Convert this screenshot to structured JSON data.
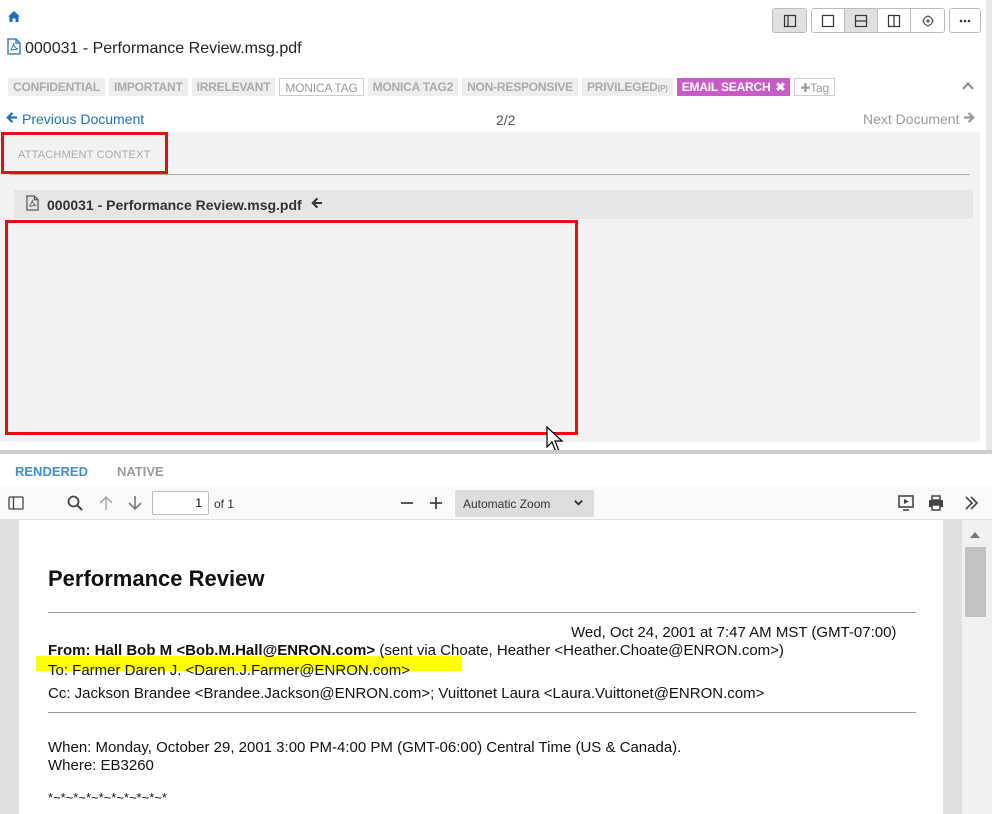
{
  "header": {
    "home_icon": "home-icon",
    "title": "000031 - Performance Review.msg.pdf"
  },
  "toolbar": {
    "layout_icons": [
      "sidebar-layout-icon",
      "single-pane-icon",
      "horizontal-split-icon",
      "vertical-split-icon",
      "settings-wheel-icon"
    ],
    "more_icon": "ellipsis-icon"
  },
  "tags": [
    {
      "label": "CONFIDENTIAL"
    },
    {
      "label": "IMPORTANT"
    },
    {
      "label": "IRRELEVANT"
    },
    {
      "label": "MONICA TAG"
    },
    {
      "label": "MONICA TAG2"
    },
    {
      "label": "NON-RESPONSIVE"
    },
    {
      "label": "PRIVILEGED",
      "suffix": "(P)"
    },
    {
      "label": "EMAIL SEARCH"
    },
    {
      "label": "Tag"
    }
  ],
  "nav": {
    "previous": "Previous Document",
    "count": "2/2",
    "next": "Next Document"
  },
  "attachment": {
    "title": "ATTACHMENT CONTEXT",
    "file": "000031 - Performance Review.msg.pdf"
  },
  "viewer_tabs": [
    "RENDERED",
    "NATIVE"
  ],
  "pdf_toolbar": {
    "page": "1",
    "of": "of 1",
    "zoom": "Automatic Zoom"
  },
  "email": {
    "title": "Performance Review",
    "date": "Wed, Oct 24, 2001 at 7:47 AM MST (GMT-07:00)",
    "from_bold": "From: Hall Bob M <Bob.M.Hall@ENRON.com>",
    "from_rest": " (sent via Choate, Heather <Heather.Choate@ENRON.com>)",
    "to": "To: Farmer Daren J. <Daren.J.Farmer@ENRON.com>",
    "cc": "Cc: Jackson Brandee <Brandee.Jackson@ENRON.com>; Vuittonet Laura <Laura.Vuittonet@ENRON.com>",
    "when": "When: Monday, October 29, 2001 3:00 PM-4:00 PM (GMT-06:00) Central Time (US & Canada).",
    "where": "Where: EB3260",
    "separator": "*~*~*~*~*~*~*~*~*~*"
  },
  "colors": {
    "accent": "#1e6fbf",
    "email_search_tag": "#c95bc9",
    "annotation_red": "#e21010",
    "highlight": "#ffff00"
  }
}
